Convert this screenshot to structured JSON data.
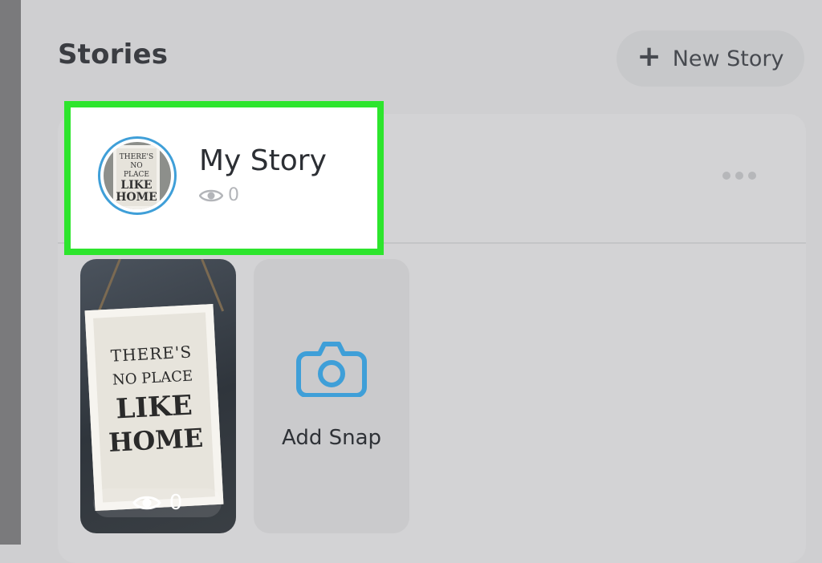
{
  "header": {
    "title": "Stories",
    "new_story_label": "New Story",
    "new_story_icon": "plus-icon"
  },
  "my_story": {
    "title": "My Story",
    "view_count": "0",
    "view_icon": "eye-icon",
    "more_icon": "more-horizontal-icon",
    "highlight_color": "#2de52d",
    "ring_color": "#3f9fd8"
  },
  "snaps": [
    {
      "image_text": [
        "THERE'S",
        "NO PLACE",
        "LIKE",
        "HOME"
      ],
      "view_count": "0"
    }
  ],
  "add_snap": {
    "label": "Add Snap",
    "icon": "camera-icon",
    "icon_color": "#3f9fd8"
  }
}
